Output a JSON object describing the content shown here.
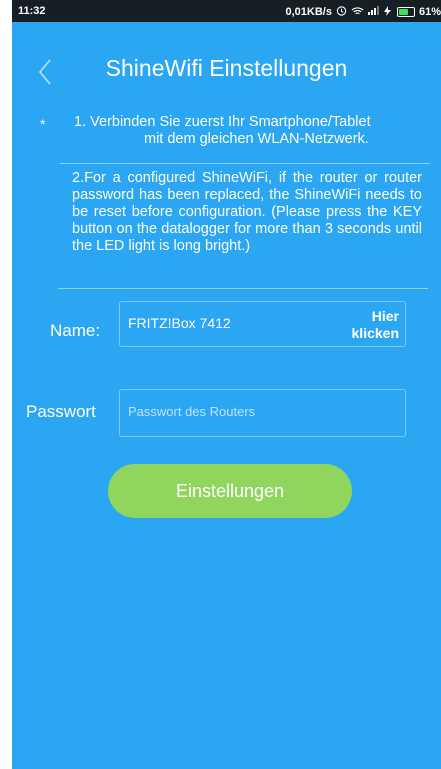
{
  "status_bar": {
    "time": "11:32",
    "net_speed": "0,01KB/s",
    "battery": "61%",
    "battery_level": 0.61,
    "icons": [
      "alarm-icon",
      "wifi-icon",
      "signal-icon",
      "charging-icon",
      "battery-icon"
    ]
  },
  "header": {
    "back_icon": "chevron-left-icon",
    "title": "ShineWifi Einstellungen"
  },
  "info": {
    "star": "*",
    "step1_line1": "1.  Verbinden Sie zuerst Ihr Smartphone/Tablet",
    "step1_line2": "mit dem gleichen WLAN-Netzwerk.",
    "step2": "2.For a configured ShineWiFi, if the router or router password has been replaced, the ShineWiFi needs to be reset before configuration. (Please press the KEY button on the datalogger for more than 3 seconds until the LED light is long bright.)"
  },
  "form": {
    "name_label": "Name:",
    "name_value": "FRITZ!Box 7412",
    "hier_line1": "Hier",
    "hier_line2": "klicken",
    "password_label": "Passwort",
    "password_placeholder": "Passwort des Routers"
  },
  "submit_label": "Einstellungen",
  "colors": {
    "background": "#2aa6f2",
    "button": "#90d65e",
    "status_bar": "#161e26"
  }
}
